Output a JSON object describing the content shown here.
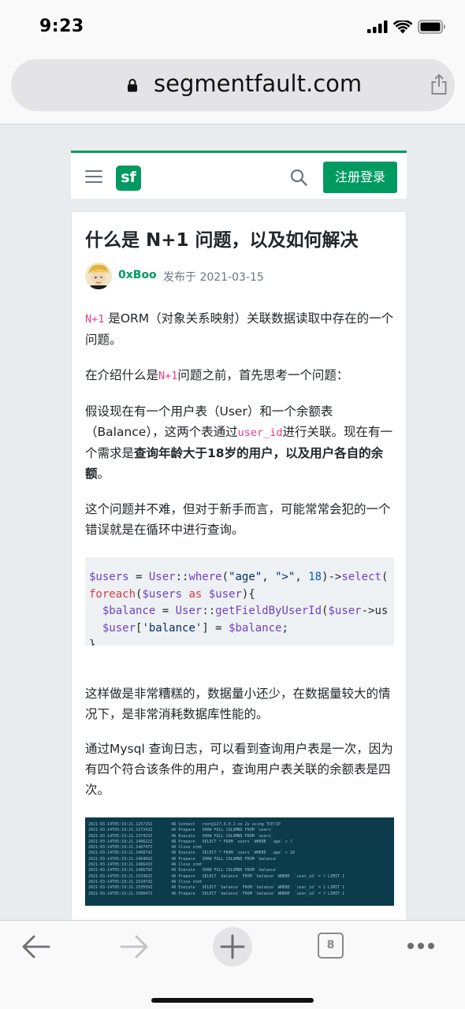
{
  "status": {
    "time": "9:23"
  },
  "browser": {
    "url": "segmentfault.com",
    "tab_count": "8"
  },
  "site": {
    "logo_text": "sf",
    "register_login": "注册登录"
  },
  "article": {
    "title": "什么是 N+1 问题，以及如何解决",
    "author": "0xBoo",
    "published": "发布于 2021-03-15",
    "p1_code": "N+1",
    "p1_text": " 是ORM（对象关系映射）关联数据读取中存在的一个问题。",
    "p2_pre": "在介绍什么是",
    "p2_code": "N+1",
    "p2_post": "问题之前，首先思考一个问题：",
    "p3_a": "假设现在有一个用户表（User）和一个余额表（Balance），这两个表通过",
    "p3_code": "user_id",
    "p3_b": "进行关联。现在有一个需求是",
    "p3_bold": "查询年龄大于18岁的用户，以及用户各自的余额",
    "p3_end": "。",
    "p4": "这个问题并不难，但对于新手而言，可能常常会犯的一个错误就是在循环中进行查询。",
    "code_lines": [
      "$users = User::where(\"age\", \">\", 18)->select(",
      "foreach($users as $user){",
      "  $balance = User::getFieldByUserId($user->us",
      "  $user['balance'] = $balance;",
      "}"
    ],
    "p5": "这样做是非常糟糕的，数据量小还少，在数据量较大的情况下，是非常消耗数据库性能的。",
    "p6": "通过Mysql 查询日志，可以看到查询用户表是一次，因为有四个符合该条件的用户，查询用户表关联的余额表是四次。",
    "log_lines": [
      "2021-03-14T05:19:21.125715Z        46 Connect   root@127.0.0.1 on 2v using TCP/IP",
      "2021-03-14T05:19:21.137343Z        46 Prepare   SHOW FULL COLUMNS FROM `users`",
      "2021-03-14T05:19:21.137423Z        46 Execute   SHOW FULL COLUMNS FROM `users`",
      "2021-03-14T05:19:21.140622Z        46 Prepare   SELECT * FROM `users` WHERE  `age` > ?",
      "2021-03-14T05:19:21.140747Z        46 Close stmt",
      "2021-03-14T05:19:21.140874Z        46 Execute   SELECT * FROM `users` WHERE  `age` > 18",
      "2021-03-14T05:19:21.146469Z        46 Prepare   SHOW FULL COLUMNS FROM `balance`",
      "2021-03-14T05:19:21.146643Z        46 Close stmt",
      "2021-03-14T05:19:21.146679Z        46 Execute   SHOW FULL COLUMNS FROM `balance`",
      "2021-03-14T05:19:21.153362Z        46 Prepare   SELECT `balance` FROM `balance` WHERE  `user_id` = ? LIMIT 1",
      "2021-03-14T05:19:21.153473Z        46 Close stmt",
      "2021-03-14T05:19:21.153559Z        46 Execute   SELECT `balance` FROM `balance` WHERE  `user_id` = 1 LIMIT 1",
      "2021-03-14T05:19:21.158047Z        46 Prepare   SELECT `balance` FROM `balance` WHERE  `user_id` = ? LIMIT 1"
    ]
  },
  "colors": {
    "brand": "#009a61",
    "code_pink": "#e83e8c",
    "log_bg": "#0c3b4c"
  }
}
